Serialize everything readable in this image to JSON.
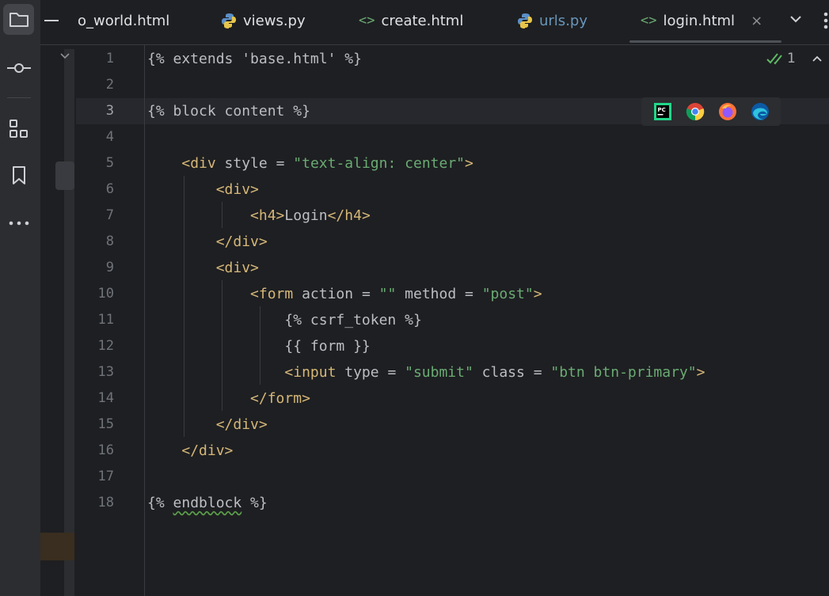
{
  "sidebar": {
    "items": [
      {
        "name": "project-folder",
        "icon": "folder-icon",
        "selected": true
      },
      {
        "name": "commit",
        "icon": "commit-icon",
        "selected": false
      },
      {
        "name": "structure",
        "icon": "structure-icon",
        "selected": false
      },
      {
        "name": "bookmarks",
        "icon": "bookmark-icon",
        "selected": false
      },
      {
        "name": "more",
        "icon": "more-dots-icon",
        "selected": false
      }
    ]
  },
  "tabs": [
    {
      "label": "o_world.html",
      "icon": "html-icon"
    },
    {
      "label": "views.py",
      "icon": "python-icon"
    },
    {
      "label": "create.html",
      "icon": "html-icon"
    },
    {
      "label": "urls.py",
      "icon": "python-icon"
    },
    {
      "label": "login.html",
      "icon": "html-icon",
      "active": true
    }
  ],
  "tab_close_glyph": "×",
  "tab_overflow_icon": "chevron-down-icon",
  "more_icon": "more-vertical-icon",
  "inspection": {
    "count": "1",
    "icon": "check-icon"
  },
  "browsers": [
    "pycharm-icon",
    "chrome-icon",
    "firefox-icon",
    "edge-icon"
  ],
  "editor": {
    "current_line": 3,
    "line_numbers": [
      "1",
      "2",
      "3",
      "4",
      "5",
      "6",
      "7",
      "8",
      "9",
      "10",
      "11",
      "12",
      "13",
      "14",
      "15",
      "16",
      "17",
      "18"
    ],
    "lines": [
      [
        {
          "c": "p",
          "t": "{% extends 'base.html' %}"
        }
      ],
      [],
      [
        {
          "c": "p",
          "t": "{% block content %}"
        }
      ],
      [],
      [
        {
          "c": "p",
          "t": "    "
        },
        {
          "c": "t",
          "t": "<div "
        },
        {
          "c": "a",
          "t": "style "
        },
        {
          "c": "p",
          "t": "= "
        },
        {
          "c": "s",
          "t": "\"text-align: center\""
        },
        {
          "c": "t",
          "t": ">"
        }
      ],
      [
        {
          "c": "p",
          "t": "        "
        },
        {
          "c": "t",
          "t": "<div>"
        }
      ],
      [
        {
          "c": "p",
          "t": "            "
        },
        {
          "c": "t",
          "t": "<h4>"
        },
        {
          "c": "p",
          "t": "Login"
        },
        {
          "c": "t",
          "t": "</h4>"
        }
      ],
      [
        {
          "c": "p",
          "t": "        "
        },
        {
          "c": "t",
          "t": "</div>"
        }
      ],
      [
        {
          "c": "p",
          "t": "        "
        },
        {
          "c": "t",
          "t": "<div>"
        }
      ],
      [
        {
          "c": "p",
          "t": "            "
        },
        {
          "c": "t",
          "t": "<form "
        },
        {
          "c": "a",
          "t": "action "
        },
        {
          "c": "p",
          "t": "= "
        },
        {
          "c": "s",
          "t": "\"\""
        },
        {
          "c": "a",
          "t": " method "
        },
        {
          "c": "p",
          "t": "= "
        },
        {
          "c": "s",
          "t": "\"post\""
        },
        {
          "c": "t",
          "t": ">"
        }
      ],
      [
        {
          "c": "p",
          "t": "                {% csrf_token %}"
        }
      ],
      [
        {
          "c": "p",
          "t": "                {{ form }}"
        }
      ],
      [
        {
          "c": "p",
          "t": "                "
        },
        {
          "c": "t",
          "t": "<input "
        },
        {
          "c": "a",
          "t": "type "
        },
        {
          "c": "p",
          "t": "= "
        },
        {
          "c": "s",
          "t": "\"submit\""
        },
        {
          "c": "a",
          "t": " class "
        },
        {
          "c": "p",
          "t": "= "
        },
        {
          "c": "s",
          "t": "\"btn btn-primary\""
        },
        {
          "c": "t",
          "t": ">"
        }
      ],
      [
        {
          "c": "p",
          "t": "            "
        },
        {
          "c": "t",
          "t": "</form>"
        }
      ],
      [
        {
          "c": "p",
          "t": "        "
        },
        {
          "c": "t",
          "t": "</div>"
        }
      ],
      [
        {
          "c": "p",
          "t": "    "
        },
        {
          "c": "t",
          "t": "</div>"
        }
      ],
      [],
      [
        {
          "c": "p",
          "t": "{% "
        },
        {
          "c": "sq",
          "t": "endblock"
        },
        {
          "c": "p",
          "t": " %}"
        }
      ]
    ]
  },
  "colors": {
    "background": "#1e1f22",
    "tag": "#d5b778",
    "string": "#6aab73",
    "plain": "#bcbec4",
    "line_number": "#6f737a"
  }
}
